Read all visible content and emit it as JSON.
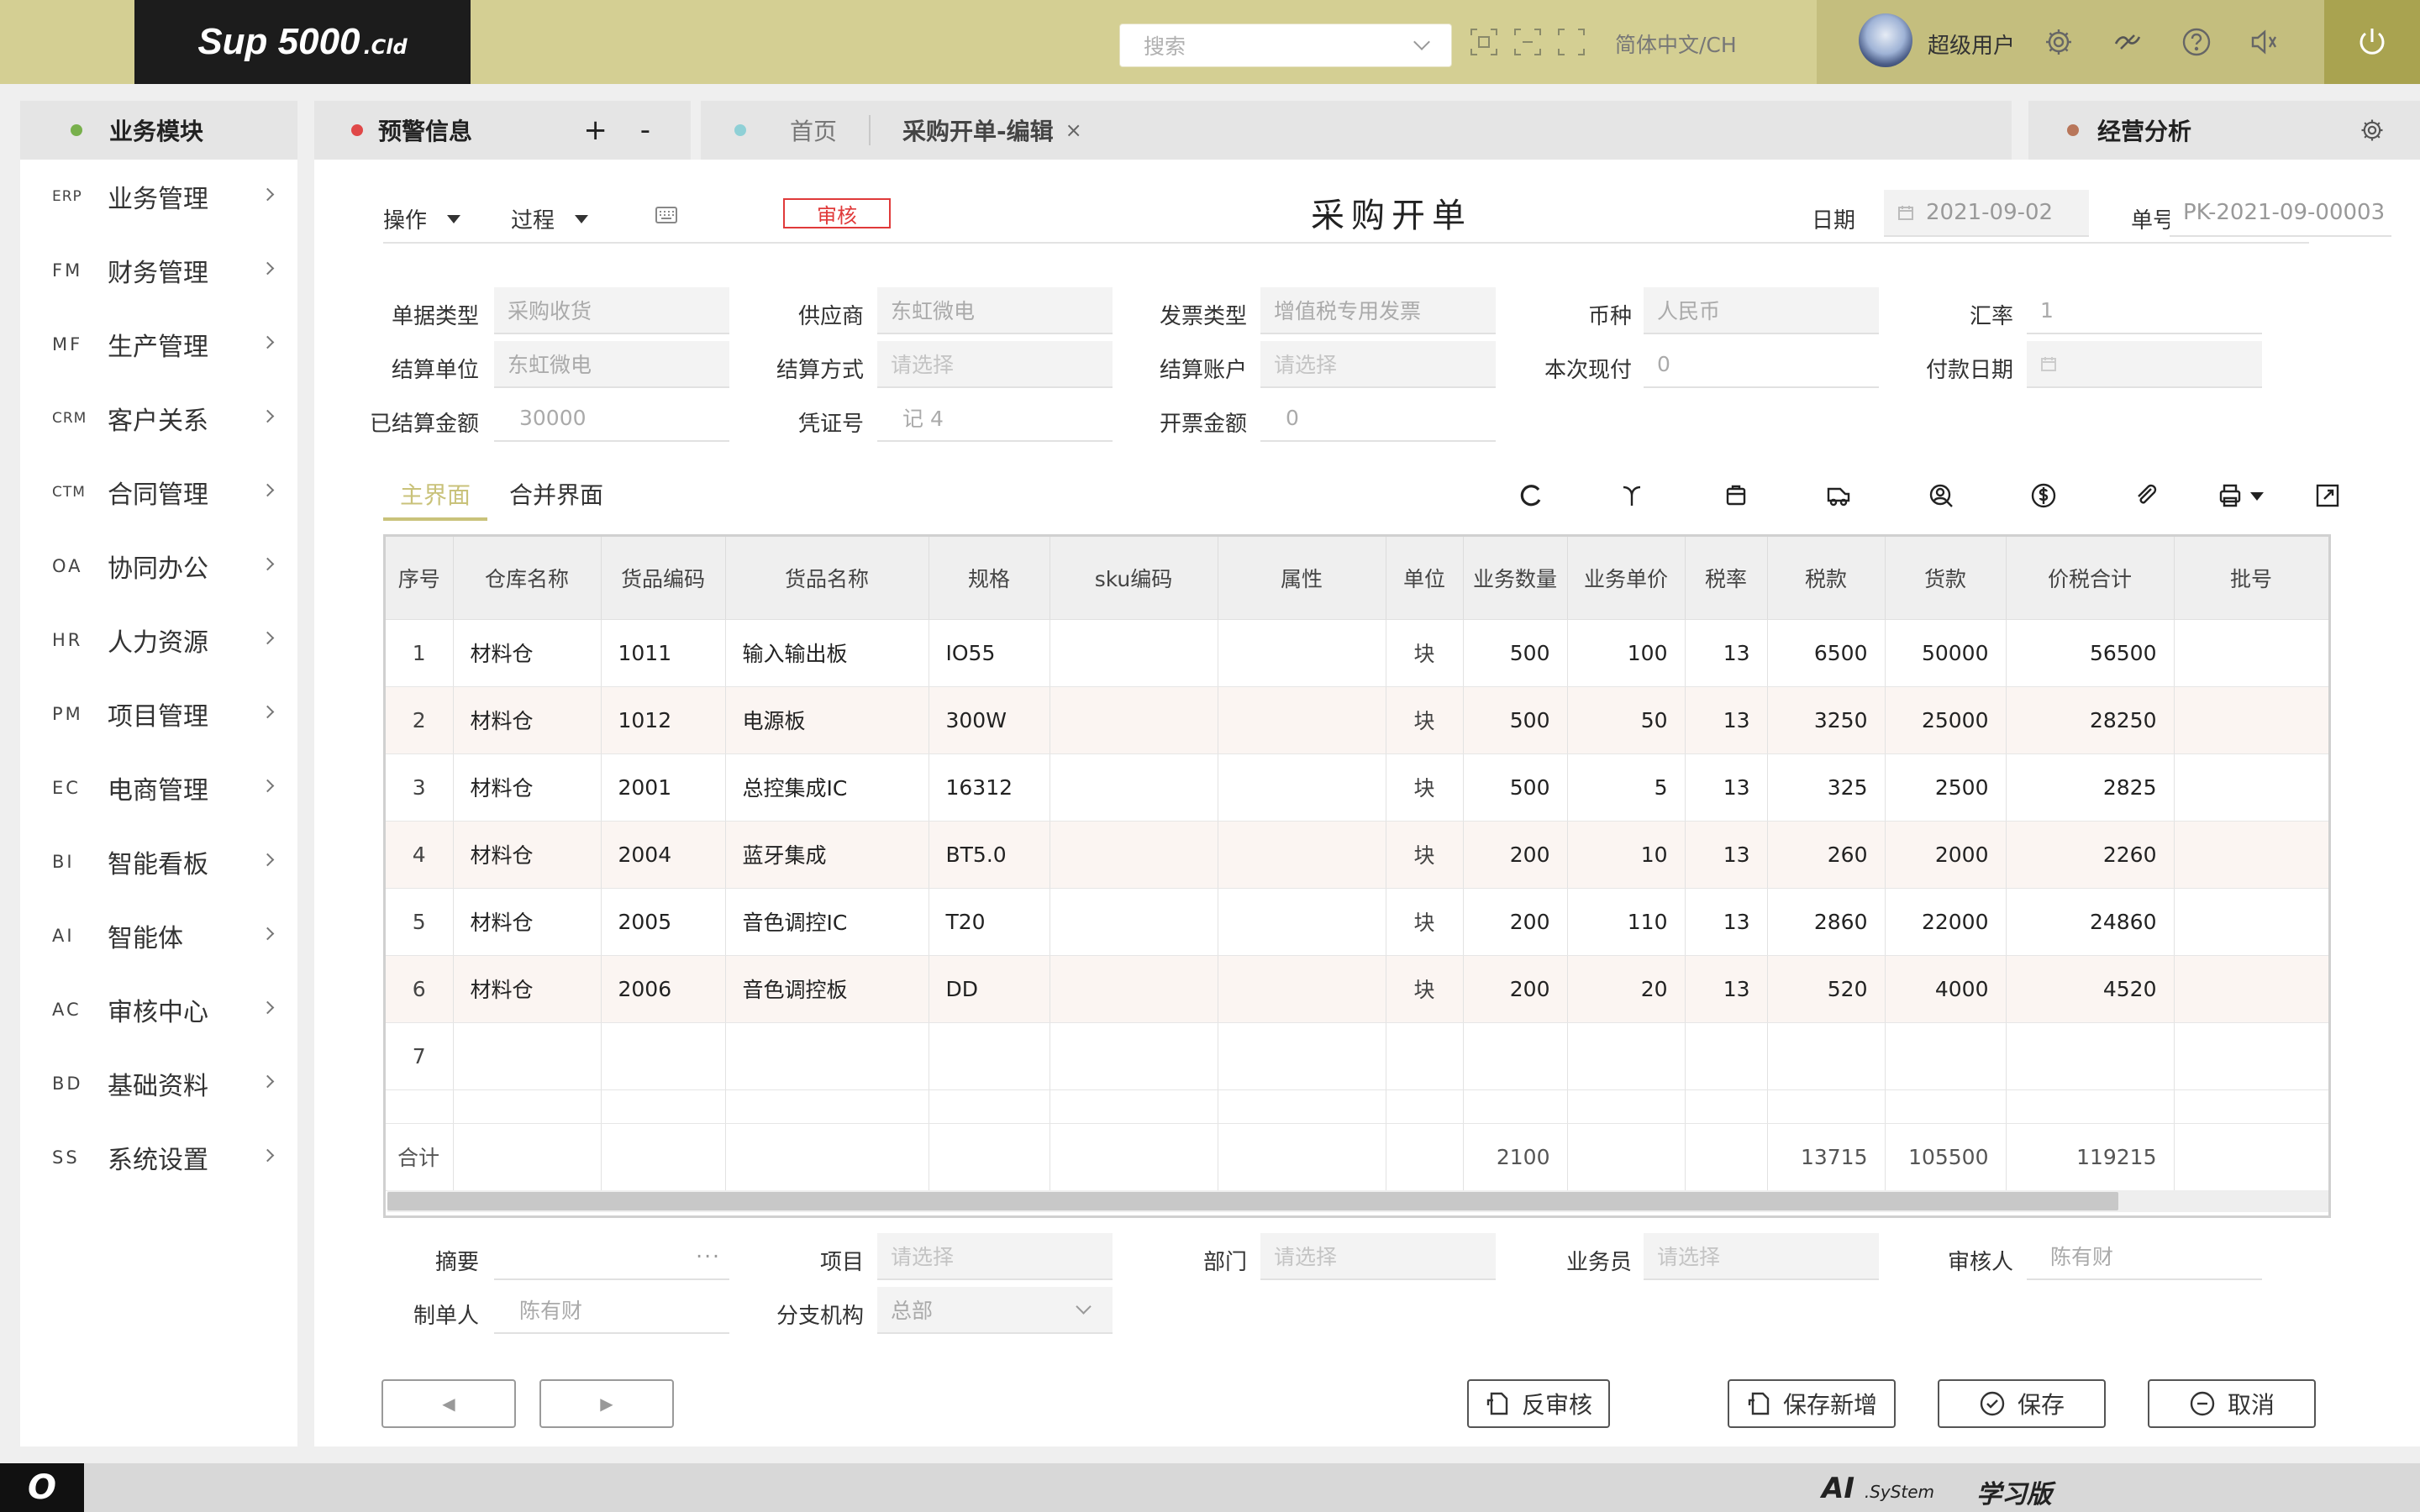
{
  "brand": {
    "main": "Sup  5000",
    "suffix": ".Cld"
  },
  "topbar": {
    "search_placeholder": "搜索",
    "language": "简体中文/CH",
    "username": "超级用户"
  },
  "sidebar": {
    "header": "业务模块",
    "items": [
      {
        "code": "ERP",
        "label": "业务管理"
      },
      {
        "code": "FM",
        "label": "财务管理"
      },
      {
        "code": "MF",
        "label": "生产管理"
      },
      {
        "code": "CRM",
        "label": "客户关系"
      },
      {
        "code": "CTM",
        "label": "合同管理"
      },
      {
        "code": "OA",
        "label": "协同办公"
      },
      {
        "code": "HR",
        "label": "人力资源"
      },
      {
        "code": "PM",
        "label": "项目管理"
      },
      {
        "code": "EC",
        "label": "电商管理"
      },
      {
        "code": "BI",
        "label": "智能看板"
      },
      {
        "code": "AI",
        "label": "智能体"
      },
      {
        "code": "AC",
        "label": "审核中心"
      },
      {
        "code": "BD",
        "label": "基础资料"
      },
      {
        "code": "SS",
        "label": "系统设置"
      }
    ]
  },
  "tabs": {
    "warning": "预警信息",
    "plus_minus": "+ -",
    "home": "首页",
    "current": "采购开单-编辑",
    "close": "×",
    "analysis": "经营分析"
  },
  "toolbar": {
    "operation": "操作",
    "process": "过程",
    "audit": "审核",
    "title": "采购开单",
    "date_label": "日期",
    "date_value": "2021-09-02",
    "no_label": "单号",
    "no_value": "PK-2021-09-00003"
  },
  "form": {
    "doc_type": {
      "label": "单据类型",
      "value": "采购收货"
    },
    "supplier": {
      "label": "供应商",
      "value": "东虹微电"
    },
    "invoice_type": {
      "label": "发票类型",
      "value": "增值税专用发票"
    },
    "currency": {
      "label": "币种",
      "value": "人民币"
    },
    "rate": {
      "label": "汇率",
      "value": "1"
    },
    "settle_unit": {
      "label": "结算单位",
      "value": "东虹微电"
    },
    "settle_method": {
      "label": "结算方式",
      "placeholder": "请选择"
    },
    "settle_account": {
      "label": "结算账户",
      "placeholder": "请选择"
    },
    "cash_now": {
      "label": "本次现付",
      "value": "0"
    },
    "pay_date": {
      "label": "付款日期",
      "value": ""
    },
    "settled_amount": {
      "label": "已结算金额",
      "value": "30000"
    },
    "voucher_no": {
      "label": "凭证号",
      "value": "记 4"
    },
    "invoice_amount": {
      "label": "开票金额",
      "value": "0"
    }
  },
  "subtabs": [
    "主界面",
    "合并界面"
  ],
  "table": {
    "columns": [
      "序号",
      "仓库名称",
      "货品编码",
      "货品名称",
      "规格",
      "sku编码",
      "属性",
      "单位",
      "业务数量",
      "业务单价",
      "税率",
      "税款",
      "货款",
      "价税合计",
      "批号"
    ],
    "rows": [
      [
        "1",
        "材料仓",
        "1011",
        "输入输出板",
        "IO55",
        "",
        "",
        "块",
        "500",
        "100",
        "13",
        "6500",
        "50000",
        "56500",
        ""
      ],
      [
        "2",
        "材料仓",
        "1012",
        "电源板",
        "300W",
        "",
        "",
        "块",
        "500",
        "50",
        "13",
        "3250",
        "25000",
        "28250",
        ""
      ],
      [
        "3",
        "材料仓",
        "2001",
        "总控集成IC",
        "16312",
        "",
        "",
        "块",
        "500",
        "5",
        "13",
        "325",
        "2500",
        "2825",
        ""
      ],
      [
        "4",
        "材料仓",
        "2004",
        "蓝牙集成",
        "BT5.0",
        "",
        "",
        "块",
        "200",
        "10",
        "13",
        "260",
        "2000",
        "2260",
        ""
      ],
      [
        "5",
        "材料仓",
        "2005",
        "音色调控IC",
        "T20",
        "",
        "",
        "块",
        "200",
        "110",
        "13",
        "2860",
        "22000",
        "24860",
        ""
      ],
      [
        "6",
        "材料仓",
        "2006",
        "音色调控板",
        "DD",
        "",
        "",
        "块",
        "200",
        "20",
        "13",
        "520",
        "4000",
        "4520",
        ""
      ],
      [
        "7",
        "",
        "",
        "",
        "",
        "",
        "",
        "",
        "",
        "",
        "",
        "",
        "",
        "",
        ""
      ]
    ],
    "total": [
      "合计",
      "",
      "",
      "",
      "",
      "",
      "",
      "",
      "2100",
      "",
      "",
      "13715",
      "105500",
      "119215",
      ""
    ]
  },
  "footer_form": {
    "summary": {
      "label": "摘要",
      "value": "···"
    },
    "project": {
      "label": "项目",
      "placeholder": "请选择"
    },
    "department": {
      "label": "部门",
      "placeholder": "请选择"
    },
    "salesman": {
      "label": "业务员",
      "placeholder": "请选择"
    },
    "reviewer": {
      "label": "审核人",
      "value": "陈有财"
    },
    "maker": {
      "label": "制单人",
      "value": "陈有财"
    },
    "branch": {
      "label": "分支机构",
      "value": "总部"
    }
  },
  "buttons": {
    "prev": "◀",
    "next": "▶",
    "unaudit": "反审核",
    "save_new": "保存新增",
    "save": "保存",
    "cancel": "取消"
  },
  "statusbar": {
    "o": "O",
    "ai": "AI",
    "ai_sub": ".SyStem",
    "learn": "学习版"
  },
  "colors": {
    "topbar": "#d4cf93",
    "accent": "#c9c27a",
    "audit_red": "#e03a3a",
    "power": "#a9a350"
  }
}
